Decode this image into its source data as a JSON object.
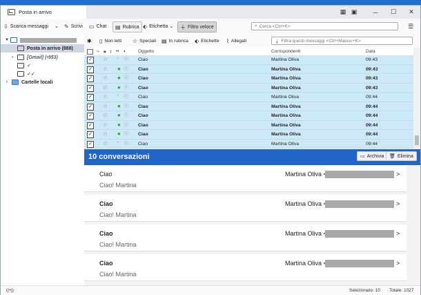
{
  "window": {
    "tab_title": "Posta in arrivo"
  },
  "toolbar": {
    "get_messages": "Scarica messaggi",
    "write": "Scrivi",
    "chat": "Chat",
    "address_book": "Rubrica",
    "tag": "Etichetta",
    "quick_filter": "Filtro veloce",
    "search_placeholder": "Cerca <Ctrl+K>"
  },
  "sidebar": {
    "inbox": "Posta in arrivo (888)",
    "gmail": "[Gmail] (•953)",
    "folder_1": "✓",
    "folder_2": "✓✓",
    "local": "Cartelle locali"
  },
  "filterbar": {
    "unread": "Non letti",
    "starred": "Speciali",
    "contact": "In rubrica",
    "tags": "Etichette",
    "attachments": "Allegati",
    "filter_placeholder": "Filtra questi messaggi <Ctrl+Maiusc+K>"
  },
  "columns": {
    "subject": "Oggetto",
    "correspondents": "Corrispondenti",
    "date": "Data"
  },
  "messages": [
    {
      "subject": "Ciao",
      "from": "Martina Oliva",
      "date": "09:43",
      "unread": false
    },
    {
      "subject": "Ciao",
      "from": "Martina Oliva",
      "date": "09:43",
      "unread": true
    },
    {
      "subject": "Ciao",
      "from": "Martina Oliva",
      "date": "09:43",
      "unread": true
    },
    {
      "subject": "Ciao",
      "from": "Martina Oliva",
      "date": "09:43",
      "unread": true
    },
    {
      "subject": "Ciao",
      "from": "Martina Oliva",
      "date": "09:44",
      "unread": false
    },
    {
      "subject": "Ciao",
      "from": "Martina Oliva",
      "date": "09:44",
      "unread": true
    },
    {
      "subject": "Ciao",
      "from": "Martina Oliva",
      "date": "09:44",
      "unread": true
    },
    {
      "subject": "Ciao",
      "from": "Martina Oliva",
      "date": "09:44",
      "unread": true
    },
    {
      "subject": "Ciao",
      "from": "Martina Oliva",
      "date": "09:44",
      "unread": true
    },
    {
      "subject": "Ciao",
      "from": "Martina Oliva",
      "date": "09:44",
      "unread": false
    }
  ],
  "summary": {
    "title": "10 conversazioni",
    "archive": "Archivia",
    "delete": "Elimina"
  },
  "conversations": [
    {
      "subject": "Ciao",
      "from": "Martina Oliva <",
      "preview": "Ciao! Martina",
      "bold": false
    },
    {
      "subject": "Ciao",
      "from": "Martina Oliva <",
      "preview": "Ciao! Martina",
      "bold": true
    },
    {
      "subject": "Ciao",
      "from": "Martina Oliva <",
      "preview": "Ciao! Martina",
      "bold": true
    },
    {
      "subject": "Ciao",
      "from": "Martina Oliva <",
      "preview": "Ciao! Martina",
      "bold": true
    }
  ],
  "status": {
    "selected": "Selezionato: 10",
    "total": "Totale: 1027"
  }
}
